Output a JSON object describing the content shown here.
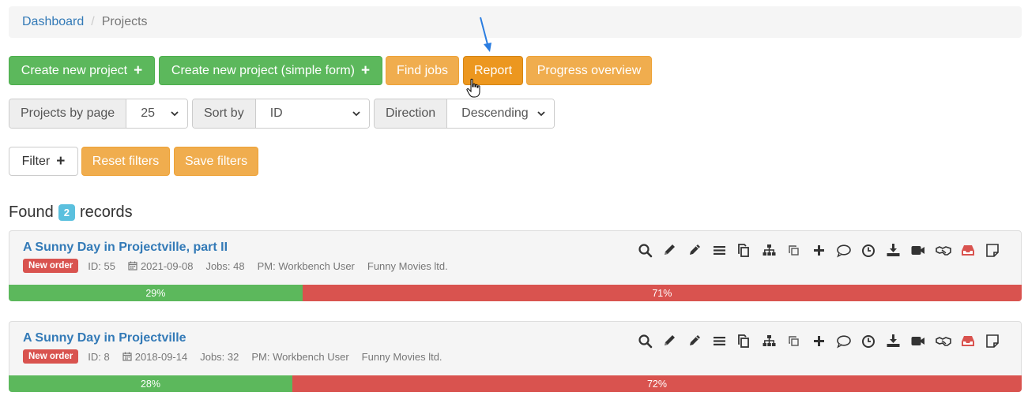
{
  "breadcrumb": {
    "home": "Dashboard",
    "separator": "/",
    "current": "Projects"
  },
  "toolbar": {
    "create_new_project": "Create new project",
    "create_new_project_simple": "Create new project (simple form)",
    "find_jobs": "Find jobs",
    "report": "Report",
    "progress_overview": "Progress overview"
  },
  "controls": {
    "projects_by_page_label": "Projects by page",
    "projects_by_page_value": "25",
    "sort_by_label": "Sort by",
    "sort_by_value": "ID",
    "direction_label": "Direction",
    "direction_value": "Descending"
  },
  "filters": {
    "filter": "Filter",
    "reset": "Reset filters",
    "save": "Save filters"
  },
  "results": {
    "found_prefix": "Found",
    "count": "2",
    "records_suffix": "records"
  },
  "colors": {
    "primary": "#337ab7",
    "success": "#5cb85c",
    "warning": "#f0ad4e",
    "danger": "#d9534f",
    "info": "#5bc0de"
  },
  "action_icons": [
    "search-icon",
    "pencil-icon",
    "pencil-alt-icon",
    "list-icon",
    "copy-icon",
    "sitemap-icon",
    "clone-icon",
    "plus-icon",
    "comment-icon",
    "clock-icon",
    "download-icon",
    "video-icon",
    "handshake-icon",
    "inbox-icon",
    "sticky-note-icon"
  ],
  "projects": [
    {
      "title": "A Sunny Day in Projectville, part II",
      "status": "New order",
      "id": "ID: 55",
      "date": "2021-09-08",
      "jobs": "Jobs: 48",
      "pm": "PM: Workbench User",
      "client": "Funny Movies ltd.",
      "progress_done": "29%",
      "progress_remaining": "71%",
      "done_fraction": 0.29
    },
    {
      "title": "A Sunny Day in Projectville",
      "status": "New order",
      "id": "ID: 8",
      "date": "2018-09-14",
      "jobs": "Jobs: 32",
      "pm": "PM: Workbench User",
      "client": "Funny Movies ltd.",
      "progress_done": "28%",
      "progress_remaining": "72%",
      "done_fraction": 0.28
    }
  ]
}
